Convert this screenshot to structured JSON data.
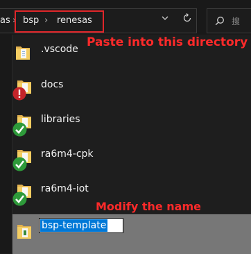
{
  "address_bar": {
    "crumbs": [
      "as",
      "bsp",
      "renesas"
    ],
    "separator": "›",
    "dropdown_icon": "chevron-down-icon",
    "refresh_icon": "refresh-icon"
  },
  "search": {
    "icon": "search-icon",
    "placeholder": "搜"
  },
  "files": [
    {
      "name": ".vscode",
      "icon": "folder-icon",
      "overlay": "none"
    },
    {
      "name": "docs",
      "icon": "folder-icon",
      "overlay": "error-overlay-icon"
    },
    {
      "name": "libraries",
      "icon": "folder-icon",
      "overlay": "check-overlay-icon"
    },
    {
      "name": "ra6m4-cpk",
      "icon": "folder-icon",
      "overlay": "check-overlay-icon"
    },
    {
      "name": "ra6m4-iot",
      "icon": "folder-icon",
      "overlay": "check-overlay-icon"
    }
  ],
  "renaming_item": {
    "value": "bsp-template",
    "icon": "folder-icon"
  },
  "annotations": {
    "paste_hint": "Paste into this directory",
    "rename_hint": "Modify the name",
    "color": "#ff2a2a"
  }
}
